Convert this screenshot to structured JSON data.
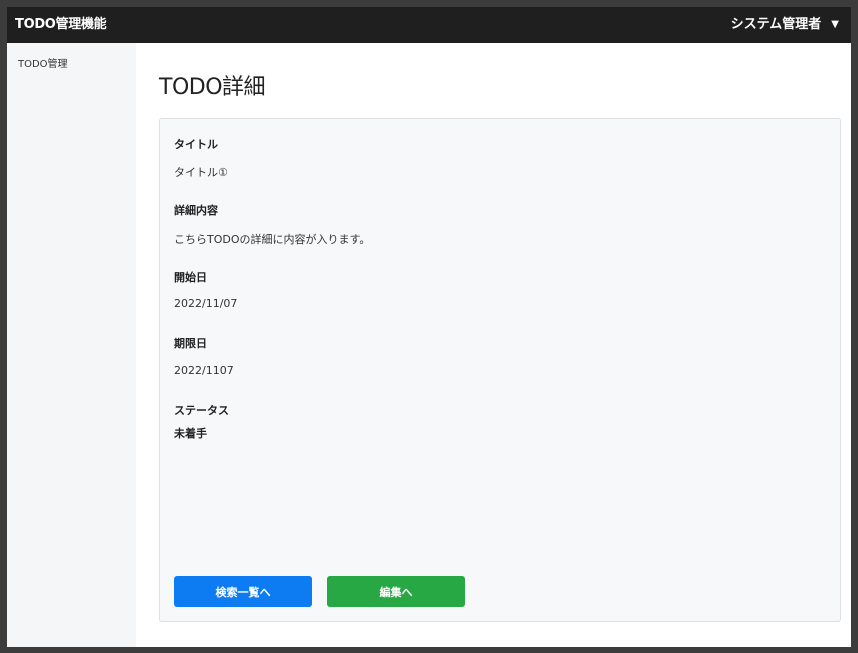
{
  "header": {
    "app_title": "TODO管理機能",
    "user_name": "システム管理者",
    "caret": "▼"
  },
  "sidebar": {
    "items": [
      {
        "label": "TODO管理"
      }
    ]
  },
  "main": {
    "page_title": "TODO詳細",
    "fields": [
      {
        "label": "タイトル",
        "value": "タイトル①"
      },
      {
        "label": "詳細内容",
        "value": "こちらTODOの詳細に内容が入ります。"
      },
      {
        "label": "開始日",
        "value": "2022/11/07"
      },
      {
        "label": "期限日",
        "value": "2022/1107"
      },
      {
        "label": "ステータス",
        "value": "未着手"
      }
    ],
    "buttons": {
      "search_list": "検索一覧へ",
      "edit": "編集へ"
    }
  }
}
